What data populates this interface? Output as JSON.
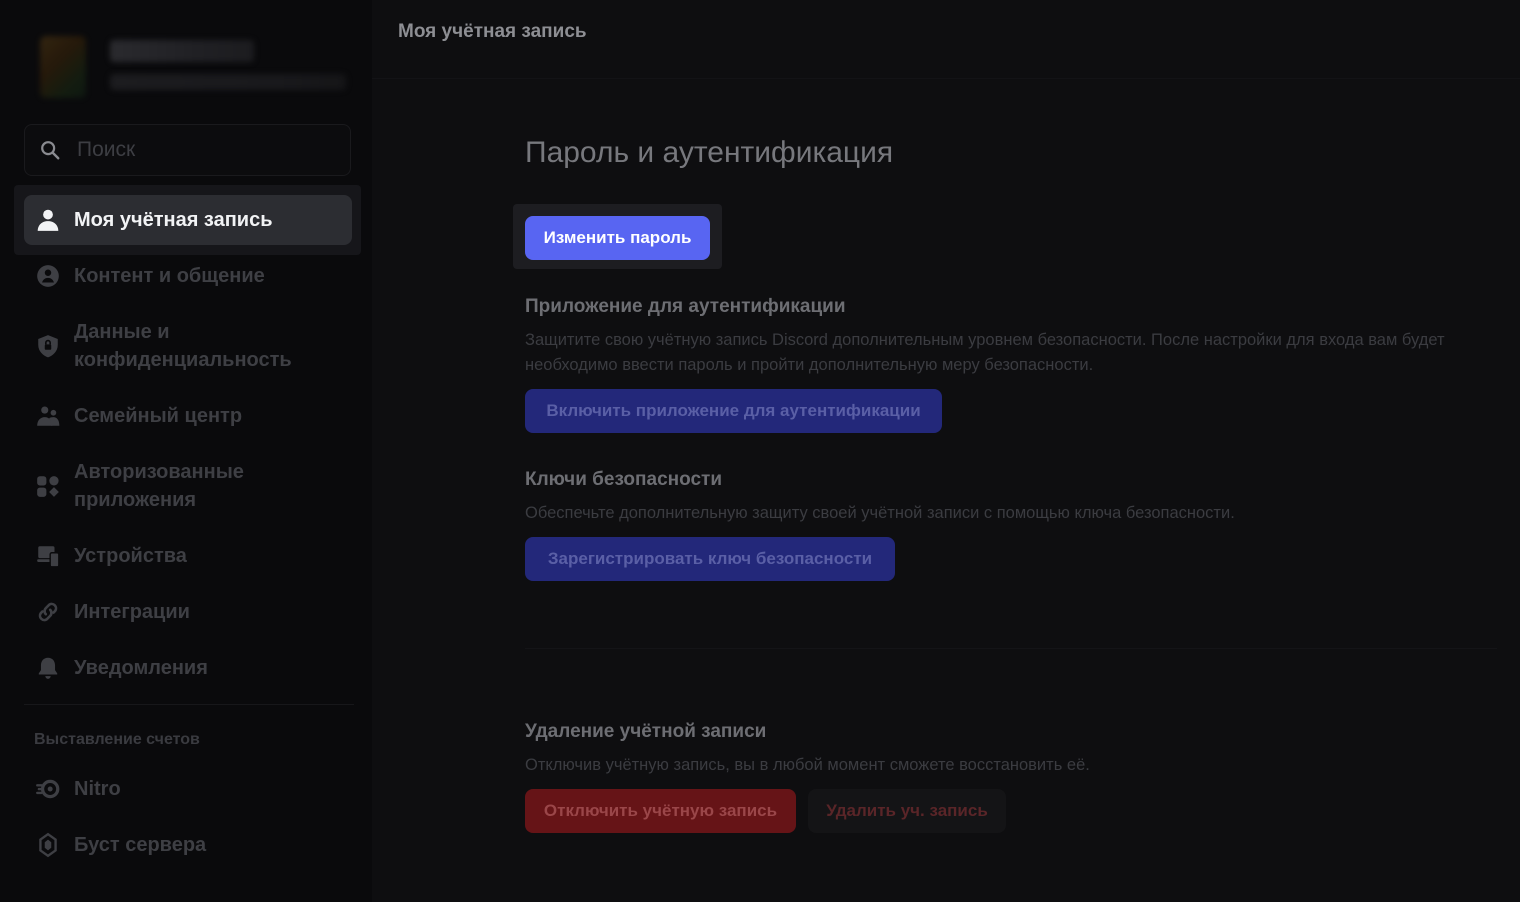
{
  "colors": {
    "accent": "#5865f2",
    "danger": "#661417",
    "background": "#0e0e10",
    "sidebar_bg": "#0a0a0c"
  },
  "sidebar": {
    "search": {
      "placeholder": "Поиск"
    },
    "items": [
      {
        "label": "Моя учётная запись",
        "icon": "person-icon",
        "active": true
      },
      {
        "label": "Контент и общение",
        "icon": "shield-person-icon"
      },
      {
        "label": "Данные и конфиденциальность",
        "icon": "shield-lock-icon"
      },
      {
        "label": "Семейный центр",
        "icon": "family-icon"
      },
      {
        "label": "Авторизованные приложения",
        "icon": "apps-icon"
      },
      {
        "label": "Устройства",
        "icon": "devices-icon"
      },
      {
        "label": "Интеграции",
        "icon": "link-icon"
      },
      {
        "label": "Уведомления",
        "icon": "bell-icon"
      }
    ],
    "billing_section": {
      "label": "Выставление счетов",
      "items": [
        {
          "label": "Nitro",
          "icon": "nitro-icon"
        },
        {
          "label": "Буст сервера",
          "icon": "boost-icon"
        }
      ]
    }
  },
  "header": {
    "title": "Моя учётная запись"
  },
  "main": {
    "section_title": "Пароль и аутентификация",
    "change_password_label": "Изменить пароль",
    "auth_app": {
      "title": "Приложение для аутентификации",
      "description": "Защитите свою учётную запись Discord дополнительным уровнем безопасности. После настройки для входа вам будет необходимо ввести пароль и пройти дополнительную меру безопасности.",
      "button_label": "Включить приложение для аутентификации"
    },
    "security_keys": {
      "title": "Ключи безопасности",
      "description": "Обеспечьте дополнительную защиту своей учётной записи с помощью ключа безопасности.",
      "button_label": "Зарегистрировать ключ безопасности"
    },
    "account_removal": {
      "title": "Удаление учётной записи",
      "description": "Отключив учётную запись, вы в любой момент сможете восстановить её.",
      "disable_label": "Отключить учётную запись",
      "delete_label": "Удалить уч. запись"
    }
  }
}
